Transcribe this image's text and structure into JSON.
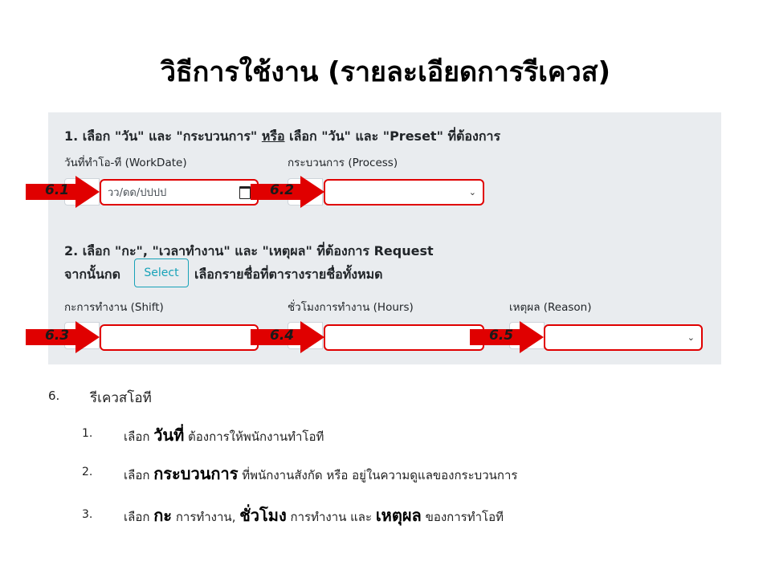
{
  "slide_title": "วิธีการใช้งาน (รายละเอียดการรีเควส)",
  "step1": {
    "pre": "1. เลือก \"วัน\" และ \"กระบวนการ\" ",
    "or": "หรือ",
    "post": " เลือก \"วัน\" และ \"Preset\" ที่ต้องการ"
  },
  "workdate": {
    "label": "วันที่ทำโอ-ที (WorkDate)",
    "placeholder": "วว/ดด/ปปปป"
  },
  "process": {
    "label": "กระบวนการ (Process)",
    "value": ""
  },
  "step2": {
    "line1": "2. เลือก \"กะ\", \"เวลาทำงาน\" และ \"เหตุผล\" ที่ต้องการ Request",
    "line2_pre": "จากนั้นกด",
    "select_button": "Select",
    "line2_post": "เลือกรายชื่อที่ตารางรายชื่อทั้งหมด"
  },
  "shift": {
    "label": "กะการทำงาน (Shift)",
    "value": ""
  },
  "hours": {
    "label": "ชั่วโมงการทำงาน (Hours)",
    "value": ""
  },
  "reason": {
    "label": "เหตุผล (Reason)",
    "value": ""
  },
  "arrows": [
    "6.1",
    "6.2",
    "6.3",
    "6.4",
    "6.5"
  ],
  "arrow_color": "#e00000",
  "notes": {
    "heading_num": "6.",
    "heading": "รีเควสโอที",
    "items": [
      {
        "num": "1.",
        "a": "เลือก ",
        "b": "วันที่",
        "c": " ต้องการให้พนักงานทำโอที"
      },
      {
        "num": "2.",
        "a": "เลือก ",
        "b": "กระบวนการ",
        "c": " ที่พนักงานสังกัด หรือ อยู่ในความดูแลของกระบวนการ"
      },
      {
        "num": "3.",
        "a": "เลือก ",
        "b": "กะ",
        "c": " การทำงาน, ",
        "d": "ชั่วโมง",
        "e": " การทำงาน และ ",
        "f": "เหตุผล",
        "g": " ของการทำโอที"
      }
    ]
  }
}
